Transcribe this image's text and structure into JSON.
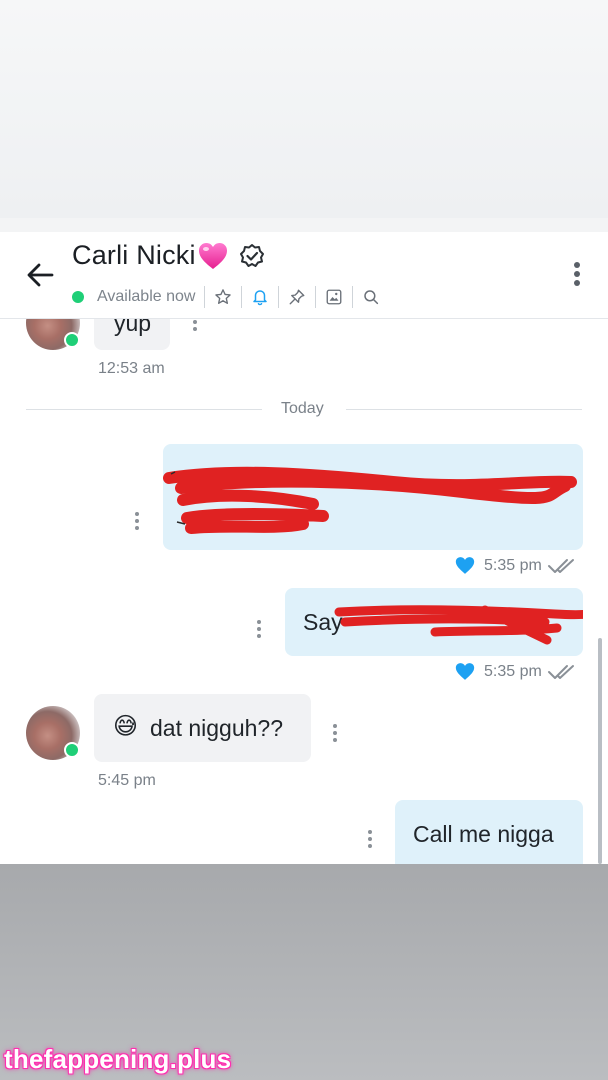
{
  "header": {
    "title": "Carli Nicki",
    "status": "Available now",
    "icons": [
      "back-arrow-icon",
      "heart-emoji-icon",
      "verified-badge-icon",
      "star-icon",
      "bell-icon",
      "pin-icon",
      "media-gallery-icon",
      "search-icon",
      "more-vertical-icon"
    ],
    "accent": "#1da1f2",
    "online_color": "#1fcf77"
  },
  "chat": {
    "first_message_text": "yup",
    "first_time": "12:53 am",
    "day_separator": "Today",
    "messages": [
      {
        "direction": "outgoing",
        "text": "[redacted]",
        "time": "5:35 pm",
        "liked": true
      },
      {
        "direction": "outgoing",
        "text_visible": "Say",
        "time": "5:35 pm",
        "liked": true
      },
      {
        "direction": "incoming",
        "emoji": "😅",
        "text": "dat nigguh??",
        "time": "5:45 pm"
      },
      {
        "direction": "outgoing",
        "text": "Call me nigga"
      }
    ]
  },
  "watermark": {
    "text": "thefappening.plus",
    "color": "#ff2fb0"
  }
}
